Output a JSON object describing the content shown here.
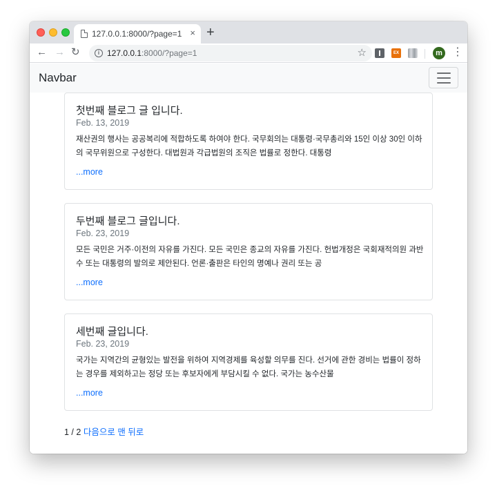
{
  "browser": {
    "tab": {
      "title": "127.0.0.1:8000/?page=1",
      "close": "×"
    },
    "newtab": "+",
    "url": {
      "host": "127.0.0.1",
      "path": ":8000/?page=1"
    },
    "nav": {
      "back": "←",
      "forward": "→",
      "reload": "↻"
    },
    "star": "☆",
    "extensions": [
      {
        "name": "puzzle-extension-icon",
        "label": ""
      },
      {
        "name": "ex-extension-icon",
        "label": "EX"
      },
      {
        "name": "gradient-extension-icon",
        "label": ""
      }
    ],
    "profile_initial": "m",
    "menu": "⋮"
  },
  "navbar": {
    "brand": "Navbar"
  },
  "posts": [
    {
      "title": "첫번째 블로그 글 입니다.",
      "date": "Feb. 13, 2019",
      "excerpt": "재산권의 행사는 공공복리에 적합하도록 하여야 한다. 국무회의는 대통령·국무총리와 15인 이상 30인 이하의 국무위원으로 구성한다. 대법원과 각급법원의 조직은 법률로 정한다. 대통령",
      "more": "...more"
    },
    {
      "title": "두번째 블로그 글입니다.",
      "date": "Feb. 23, 2019",
      "excerpt": "모든 국민은 거주·이전의 자유를 가진다. 모든 국민은 종교의 자유를 가진다. 헌법개정은 국회재적의원 과반수 또는 대통령의 발의로 제안된다. 언론·출판은 타인의 명예나 권리 또는 공",
      "more": "...more"
    },
    {
      "title": "세번째 글입니다.",
      "date": "Feb. 23, 2019",
      "excerpt": "국가는 지역간의 균형있는 발전을 위하여 지역경제를 육성할 의무를 진다. 선거에 관한 경비는 법률이 정하는 경우를 제외하고는 정당 또는 후보자에게 부담시킬 수 없다. 국가는 농수산물",
      "more": "...more"
    }
  ],
  "pagination": {
    "current": "1 / 2",
    "next": "다음으로",
    "last": "맨 뒤로"
  },
  "colors": {
    "link": "#0d6efd",
    "navbar_bg": "#f8f9fa",
    "text": "#212529",
    "muted": "#6c757d"
  }
}
